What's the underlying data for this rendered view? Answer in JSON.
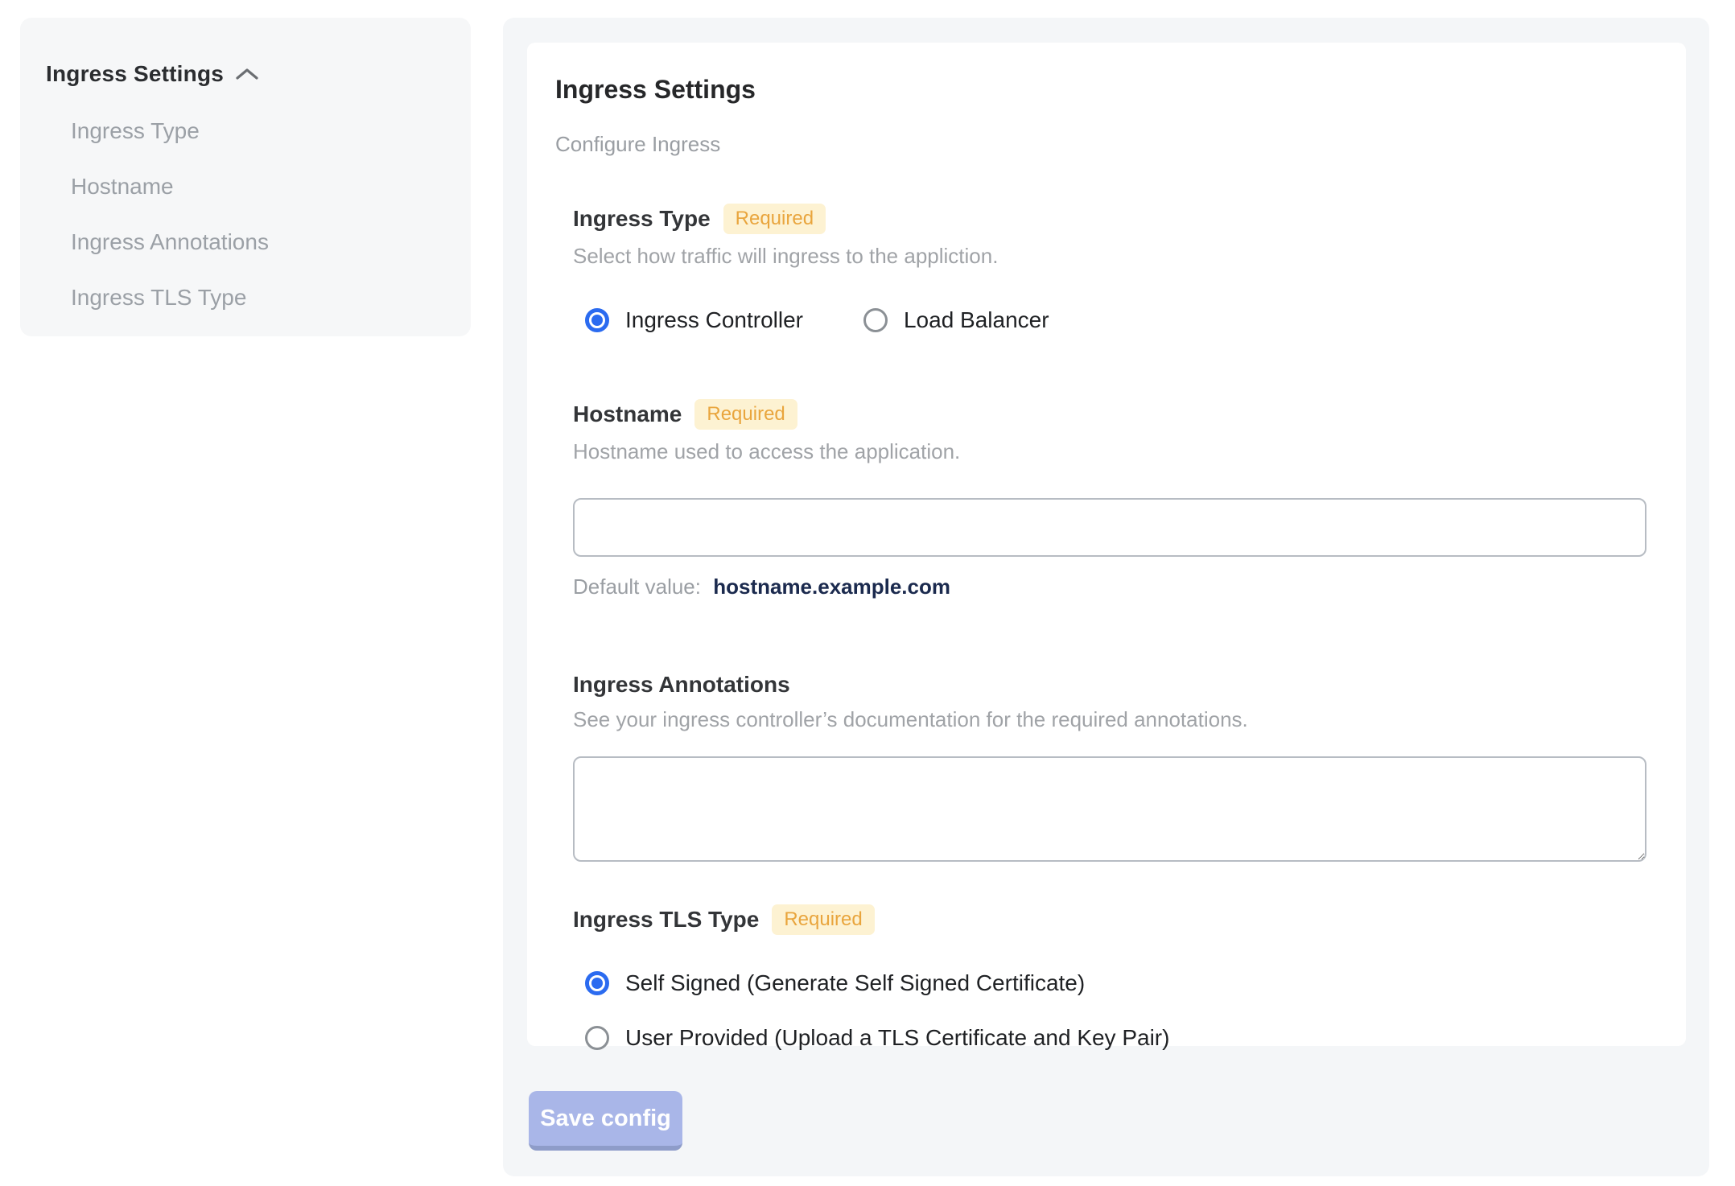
{
  "sidebar": {
    "title": "Ingress Settings",
    "collapse_icon": "chevron-up-icon",
    "items": [
      {
        "label": "Ingress Type"
      },
      {
        "label": "Hostname"
      },
      {
        "label": "Ingress Annotations"
      },
      {
        "label": "Ingress TLS Type"
      }
    ]
  },
  "panel": {
    "title": "Ingress Settings",
    "subtitle": "Configure Ingress",
    "sections": {
      "ingress_type": {
        "label": "Ingress Type",
        "required_badge": "Required",
        "description": "Select how traffic will ingress to the appliction.",
        "options": [
          {
            "label": "Ingress Controller",
            "selected": true
          },
          {
            "label": "Load Balancer",
            "selected": false
          }
        ]
      },
      "hostname": {
        "label": "Hostname",
        "required_badge": "Required",
        "description": "Hostname used to access the application.",
        "input_value": "",
        "default_value_label": "Default value:",
        "default_value": "hostname.example.com"
      },
      "ingress_annotations": {
        "label": "Ingress Annotations",
        "description": "See your ingress controller’s documentation for the required annotations.",
        "textarea_value": ""
      },
      "ingress_tls_type": {
        "label": "Ingress TLS Type",
        "required_badge": "Required",
        "options": [
          {
            "label": "Self Signed (Generate Self Signed Certificate)",
            "selected": true
          },
          {
            "label": "User Provided (Upload a TLS Certificate and Key Pair)",
            "selected": false
          }
        ]
      }
    },
    "save_button": "Save config"
  },
  "colors": {
    "accent_blue": "#2b6bf0",
    "badge_bg": "#fdf2d2",
    "badge_text": "#e9a53d",
    "panel_bg": "#f4f6f8",
    "sidebar_bg": "#f6f7f8",
    "save_button_bg": "#a9b6e8",
    "save_button_edge": "#8e9cc9",
    "default_value_text": "#1b2a4e"
  }
}
